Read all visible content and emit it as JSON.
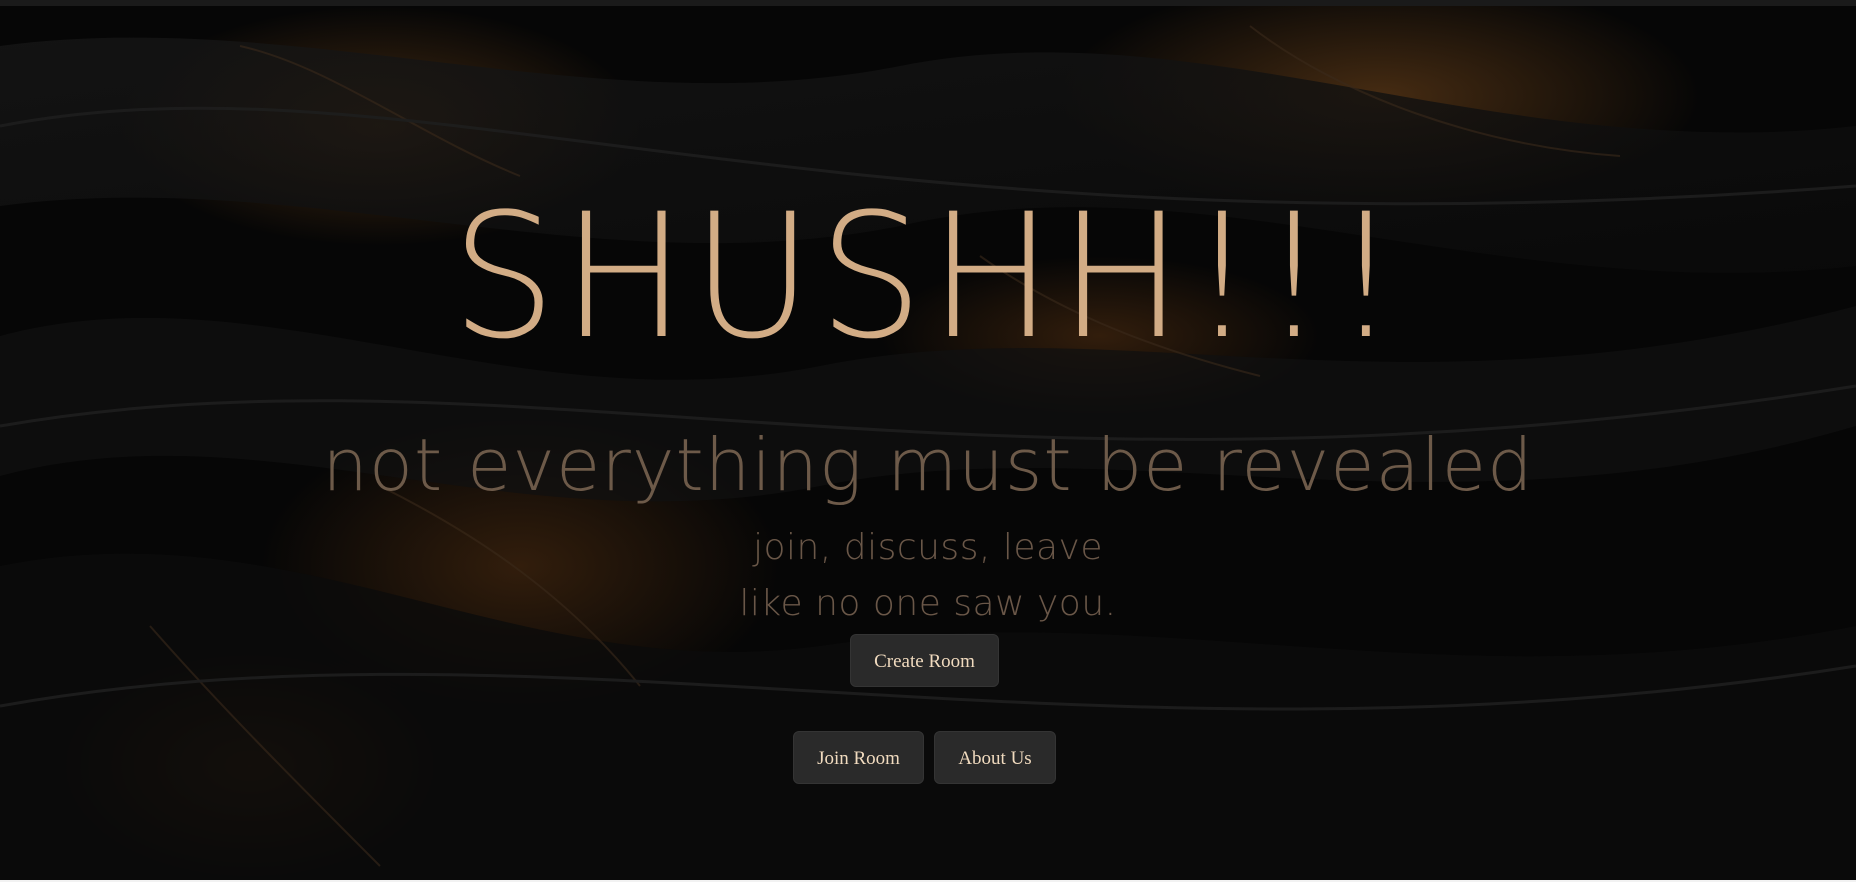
{
  "hero": {
    "title": "SHUSHH!!!",
    "tagline": "not everything must be revealed",
    "subline_1": "join, discuss, leave",
    "subline_2": "like no one saw you."
  },
  "buttons": {
    "create_room": "Create Room",
    "join_room": "Join Room",
    "about_us": "About Us"
  },
  "colors": {
    "background": "#050505",
    "title": "#d2ac85",
    "tagline": "#6d5a49",
    "button_bg": "#2a2a2a",
    "button_text": "#f1dbbf",
    "accent_amber": "#7a4a1c"
  }
}
